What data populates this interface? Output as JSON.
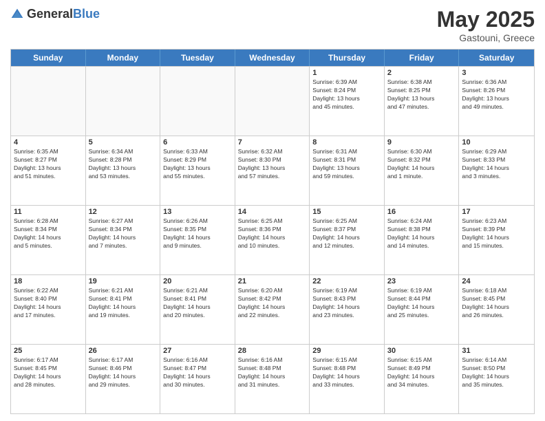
{
  "logo": {
    "general": "General",
    "blue": "Blue"
  },
  "title": {
    "month": "May 2025",
    "location": "Gastouni, Greece"
  },
  "header_days": [
    "Sunday",
    "Monday",
    "Tuesday",
    "Wednesday",
    "Thursday",
    "Friday",
    "Saturday"
  ],
  "weeks": [
    [
      {
        "day": "",
        "info": ""
      },
      {
        "day": "",
        "info": ""
      },
      {
        "day": "",
        "info": ""
      },
      {
        "day": "",
        "info": ""
      },
      {
        "day": "1",
        "info": "Sunrise: 6:39 AM\nSunset: 8:24 PM\nDaylight: 13 hours\nand 45 minutes."
      },
      {
        "day": "2",
        "info": "Sunrise: 6:38 AM\nSunset: 8:25 PM\nDaylight: 13 hours\nand 47 minutes."
      },
      {
        "day": "3",
        "info": "Sunrise: 6:36 AM\nSunset: 8:26 PM\nDaylight: 13 hours\nand 49 minutes."
      }
    ],
    [
      {
        "day": "4",
        "info": "Sunrise: 6:35 AM\nSunset: 8:27 PM\nDaylight: 13 hours\nand 51 minutes."
      },
      {
        "day": "5",
        "info": "Sunrise: 6:34 AM\nSunset: 8:28 PM\nDaylight: 13 hours\nand 53 minutes."
      },
      {
        "day": "6",
        "info": "Sunrise: 6:33 AM\nSunset: 8:29 PM\nDaylight: 13 hours\nand 55 minutes."
      },
      {
        "day": "7",
        "info": "Sunrise: 6:32 AM\nSunset: 8:30 PM\nDaylight: 13 hours\nand 57 minutes."
      },
      {
        "day": "8",
        "info": "Sunrise: 6:31 AM\nSunset: 8:31 PM\nDaylight: 13 hours\nand 59 minutes."
      },
      {
        "day": "9",
        "info": "Sunrise: 6:30 AM\nSunset: 8:32 PM\nDaylight: 14 hours\nand 1 minute."
      },
      {
        "day": "10",
        "info": "Sunrise: 6:29 AM\nSunset: 8:33 PM\nDaylight: 14 hours\nand 3 minutes."
      }
    ],
    [
      {
        "day": "11",
        "info": "Sunrise: 6:28 AM\nSunset: 8:34 PM\nDaylight: 14 hours\nand 5 minutes."
      },
      {
        "day": "12",
        "info": "Sunrise: 6:27 AM\nSunset: 8:34 PM\nDaylight: 14 hours\nand 7 minutes."
      },
      {
        "day": "13",
        "info": "Sunrise: 6:26 AM\nSunset: 8:35 PM\nDaylight: 14 hours\nand 9 minutes."
      },
      {
        "day": "14",
        "info": "Sunrise: 6:25 AM\nSunset: 8:36 PM\nDaylight: 14 hours\nand 10 minutes."
      },
      {
        "day": "15",
        "info": "Sunrise: 6:25 AM\nSunset: 8:37 PM\nDaylight: 14 hours\nand 12 minutes."
      },
      {
        "day": "16",
        "info": "Sunrise: 6:24 AM\nSunset: 8:38 PM\nDaylight: 14 hours\nand 14 minutes."
      },
      {
        "day": "17",
        "info": "Sunrise: 6:23 AM\nSunset: 8:39 PM\nDaylight: 14 hours\nand 15 minutes."
      }
    ],
    [
      {
        "day": "18",
        "info": "Sunrise: 6:22 AM\nSunset: 8:40 PM\nDaylight: 14 hours\nand 17 minutes."
      },
      {
        "day": "19",
        "info": "Sunrise: 6:21 AM\nSunset: 8:41 PM\nDaylight: 14 hours\nand 19 minutes."
      },
      {
        "day": "20",
        "info": "Sunrise: 6:21 AM\nSunset: 8:41 PM\nDaylight: 14 hours\nand 20 minutes."
      },
      {
        "day": "21",
        "info": "Sunrise: 6:20 AM\nSunset: 8:42 PM\nDaylight: 14 hours\nand 22 minutes."
      },
      {
        "day": "22",
        "info": "Sunrise: 6:19 AM\nSunset: 8:43 PM\nDaylight: 14 hours\nand 23 minutes."
      },
      {
        "day": "23",
        "info": "Sunrise: 6:19 AM\nSunset: 8:44 PM\nDaylight: 14 hours\nand 25 minutes."
      },
      {
        "day": "24",
        "info": "Sunrise: 6:18 AM\nSunset: 8:45 PM\nDaylight: 14 hours\nand 26 minutes."
      }
    ],
    [
      {
        "day": "25",
        "info": "Sunrise: 6:17 AM\nSunset: 8:45 PM\nDaylight: 14 hours\nand 28 minutes."
      },
      {
        "day": "26",
        "info": "Sunrise: 6:17 AM\nSunset: 8:46 PM\nDaylight: 14 hours\nand 29 minutes."
      },
      {
        "day": "27",
        "info": "Sunrise: 6:16 AM\nSunset: 8:47 PM\nDaylight: 14 hours\nand 30 minutes."
      },
      {
        "day": "28",
        "info": "Sunrise: 6:16 AM\nSunset: 8:48 PM\nDaylight: 14 hours\nand 31 minutes."
      },
      {
        "day": "29",
        "info": "Sunrise: 6:15 AM\nSunset: 8:48 PM\nDaylight: 14 hours\nand 33 minutes."
      },
      {
        "day": "30",
        "info": "Sunrise: 6:15 AM\nSunset: 8:49 PM\nDaylight: 14 hours\nand 34 minutes."
      },
      {
        "day": "31",
        "info": "Sunrise: 6:14 AM\nSunset: 8:50 PM\nDaylight: 14 hours\nand 35 minutes."
      }
    ]
  ]
}
